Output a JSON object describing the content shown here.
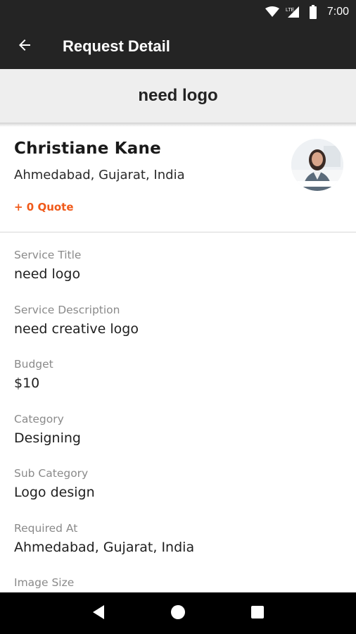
{
  "status_bar": {
    "time": "7:00",
    "network_label": "LTE"
  },
  "app_bar": {
    "title": "Request Detail"
  },
  "request": {
    "title": "need logo"
  },
  "user": {
    "name": "Christiane Kane",
    "location": "Ahmedabad, Gujarat, India",
    "quote_link": "+ 0 Quote"
  },
  "details": [
    {
      "label": "Service Title",
      "value": "need logo"
    },
    {
      "label": "Service Description",
      "value": "need creative logo"
    },
    {
      "label": "Budget",
      "value": "$10"
    },
    {
      "label": "Category",
      "value": "Designing"
    },
    {
      "label": "Sub Category",
      "value": "Logo design"
    },
    {
      "label": "Required At",
      "value": "Ahmedabad, Gujarat, India"
    },
    {
      "label": "Image Size",
      "value": ""
    }
  ],
  "colors": {
    "app_bar": "#242424",
    "strip": "#eeeeee",
    "accent": "#f05a1a",
    "label": "#8a8a8a",
    "value": "#1e1e1e"
  },
  "icons": {
    "back": "arrow-left-icon",
    "wifi": "wifi-icon",
    "cell": "cell-signal-icon",
    "battery": "battery-icon",
    "nav_back": "triangle-back-icon",
    "nav_home": "circle-home-icon",
    "nav_recents": "square-recents-icon"
  }
}
